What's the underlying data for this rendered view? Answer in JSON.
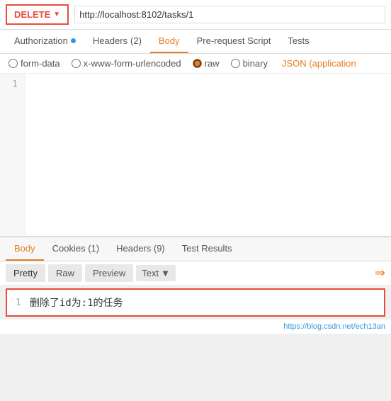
{
  "topbar": {
    "method": "DELETE",
    "url": "http://localhost:8102/tasks/1"
  },
  "requestTabs": [
    {
      "label": "Authorization",
      "active": false,
      "dot": true
    },
    {
      "label": "Headers",
      "badge": "(2)",
      "active": false
    },
    {
      "label": "Body",
      "active": true
    },
    {
      "label": "Pre-request Script",
      "active": false
    },
    {
      "label": "Tests",
      "active": false
    }
  ],
  "bodyTypes": [
    {
      "label": "form-data",
      "value": "form-data",
      "checked": false
    },
    {
      "label": "x-www-form-urlencoded",
      "value": "urlencoded",
      "checked": false
    },
    {
      "label": "raw",
      "value": "raw",
      "checked": true
    },
    {
      "label": "binary",
      "value": "binary",
      "checked": false
    }
  ],
  "jsonLabel": "JSON (application",
  "codeLineNum": "1",
  "codeContent": "",
  "responseTabs": [
    {
      "label": "Body",
      "active": true
    },
    {
      "label": "Cookies (1)",
      "active": false
    },
    {
      "label": "Headers (9)",
      "active": false
    },
    {
      "label": "Test Results",
      "active": false
    }
  ],
  "respSubTabs": [
    {
      "label": "Pretty",
      "active": true
    },
    {
      "label": "Raw",
      "active": false
    },
    {
      "label": "Preview",
      "active": false
    },
    {
      "label": "Text",
      "dropdown": true
    }
  ],
  "resultRow": {
    "lineNum": "1",
    "text": "删除了id为:1的任务"
  },
  "watermark": "https://blog.csdn.net/ech13an"
}
